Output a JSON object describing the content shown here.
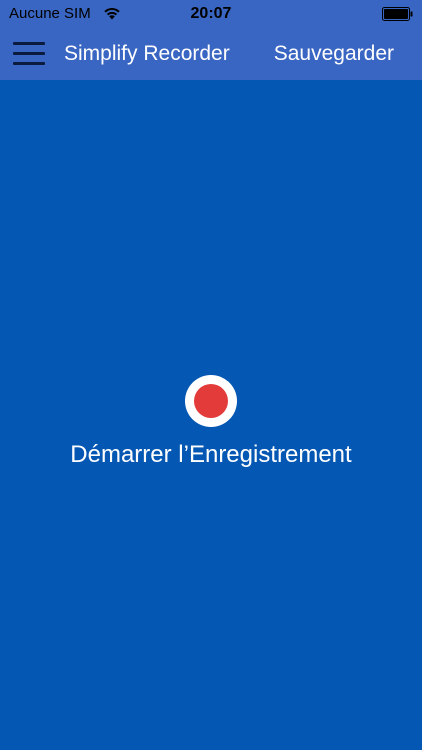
{
  "status_bar": {
    "carrier": "Aucune SIM",
    "time": "20:07",
    "wifi_icon": "wifi-icon",
    "battery_icon": "battery-icon"
  },
  "nav_bar": {
    "menu_icon": "hamburger-menu-icon",
    "title": "Simplify Recorder",
    "save_label": "Sauvegarder"
  },
  "main": {
    "record_icon": "record-icon",
    "record_label": "Démarrer l’Enregistrement"
  },
  "colors": {
    "background": "#0457b3",
    "nav_background": "#3a66c3",
    "record_red": "#e23b3a",
    "text": "#ffffff"
  }
}
